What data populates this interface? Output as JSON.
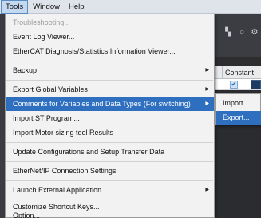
{
  "menubar": {
    "items": [
      "Tools",
      "Window",
      "Help"
    ]
  },
  "background": {
    "column_header": "Constant",
    "checkbox_mark": "✔"
  },
  "tools_menu": {
    "items": [
      {
        "label": "Troubleshooting...",
        "enabled": false,
        "submenu": false
      },
      {
        "label": "Event Log Viewer...",
        "enabled": true,
        "submenu": false
      },
      {
        "label": "EtherCAT Diagnosis/Statistics Information Viewer...",
        "enabled": true,
        "submenu": false
      },
      {
        "label": "Backup",
        "enabled": true,
        "submenu": true
      },
      {
        "label": "Export Global Variables",
        "enabled": true,
        "submenu": true
      },
      {
        "label": "Comments for Variables and Data Types (For switching)",
        "enabled": true,
        "submenu": true,
        "highlighted": true
      },
      {
        "label": "Import ST Program...",
        "enabled": true,
        "submenu": false
      },
      {
        "label": "Import Motor sizing tool Results",
        "enabled": true,
        "submenu": false
      },
      {
        "label": "Update Configurations and Setup Transfer Data",
        "enabled": true,
        "submenu": false
      },
      {
        "label": "EtherNet/IP Connection Settings",
        "enabled": true,
        "submenu": false
      },
      {
        "label": "Launch External Application",
        "enabled": true,
        "submenu": true
      },
      {
        "label": "Customize Shortcut Keys...",
        "enabled": true,
        "submenu": false
      },
      {
        "label": "Option...",
        "enabled": true,
        "submenu": false
      }
    ]
  },
  "submenu": {
    "items": [
      {
        "label": "Import...",
        "highlighted": false
      },
      {
        "label": "Export...",
        "highlighted": true
      }
    ]
  },
  "icons": {
    "submenu_arrow": "▶"
  },
  "colors": {
    "highlight": "#2f6fc0",
    "menu_bg": "#f2f2f2",
    "menubar_bg": "#dfe3ea"
  }
}
